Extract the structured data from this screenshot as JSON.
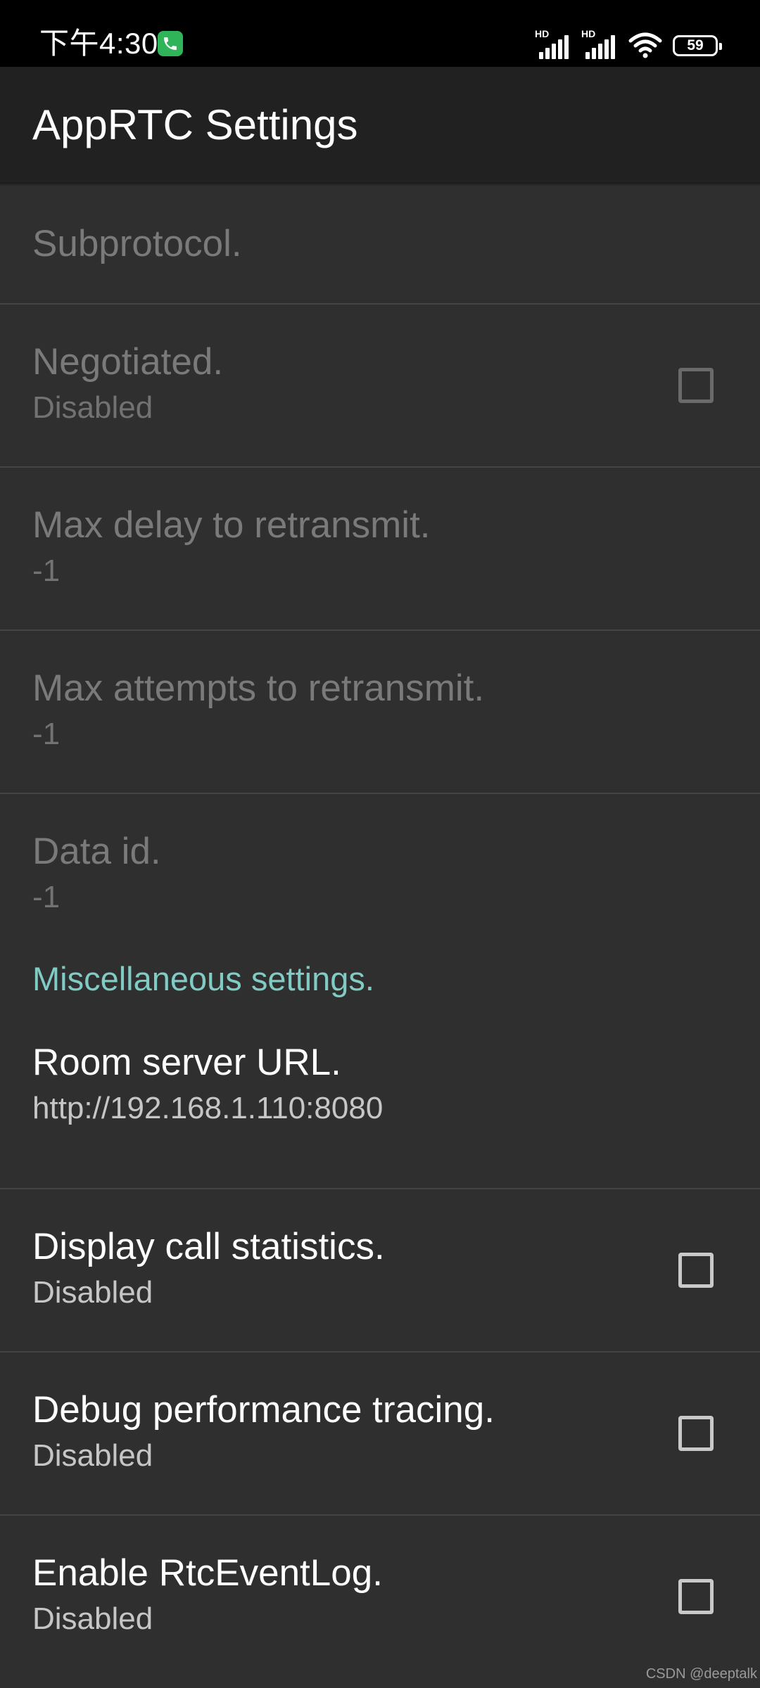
{
  "status_bar": {
    "time": "下午4:30",
    "network_1": "HD",
    "network_2": "HD",
    "battery": "59",
    "icons": [
      "call-icon",
      "signal-icon",
      "signal-icon",
      "wifi-icon",
      "battery-icon"
    ]
  },
  "app_bar": {
    "title": "AppRTC Settings"
  },
  "prefs": {
    "subprotocol": {
      "title": "Subprotocol."
    },
    "negotiated": {
      "title": "Negotiated.",
      "summary": "Disabled",
      "checked": false
    },
    "max_delay": {
      "title": "Max delay to retransmit.",
      "summary": "-1"
    },
    "max_attempts": {
      "title": "Max attempts to retransmit.",
      "summary": "-1"
    },
    "data_id": {
      "title": "Data id.",
      "summary": "-1"
    },
    "misc_category": {
      "title": "Miscellaneous settings."
    },
    "room_server": {
      "title": "Room server URL.",
      "summary": "http://192.168.1.110:8080"
    },
    "call_stats": {
      "title": "Display call statistics.",
      "summary": "Disabled",
      "checked": false
    },
    "perf_tracing": {
      "title": "Debug performance tracing.",
      "summary": "Disabled",
      "checked": false
    },
    "rtc_event_log": {
      "title": "Enable RtcEventLog.",
      "summary": "Disabled",
      "checked": false
    }
  },
  "watermark": "CSDN @deeptalk",
  "colors": {
    "background": "#2f2f2f",
    "app_bar": "#212121",
    "accent": "#80cbc4",
    "status_bar": "#000000",
    "call_green": "#2fb45a"
  }
}
